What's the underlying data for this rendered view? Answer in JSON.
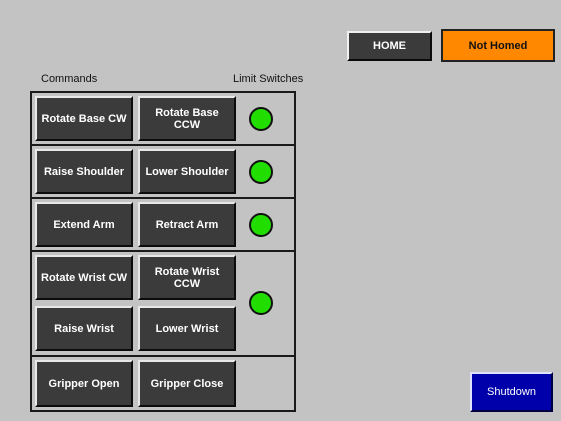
{
  "header": {
    "home_label": "HOME",
    "status_label": "Not Homed",
    "status_color": "#ff8800"
  },
  "labels": {
    "commands": "Commands",
    "limit_switches": "Limit Switches"
  },
  "commands": {
    "rotate_base_cw": "Rotate Base CW",
    "rotate_base_ccw": "Rotate Base\nCCW",
    "raise_shoulder": "Raise Shoulder",
    "lower_shoulder": "Lower Shoulder",
    "extend_arm": "Extend Arm",
    "retract_arm": "Retract Arm",
    "rotate_wrist_cw": "Rotate Wrist CW",
    "rotate_wrist_ccw": "Rotate Wrist\nCCW",
    "raise_wrist": "Raise Wrist",
    "lower_wrist": "Lower Wrist",
    "gripper_open": "Gripper Open",
    "gripper_close": "Gripper Close"
  },
  "limit_switches": {
    "base": "on",
    "shoulder": "on",
    "arm": "on",
    "wrist": "on",
    "indicator_color": "#22dd00"
  },
  "footer": {
    "shutdown_label": "Shutdown",
    "shutdown_color": "#0000aa"
  }
}
